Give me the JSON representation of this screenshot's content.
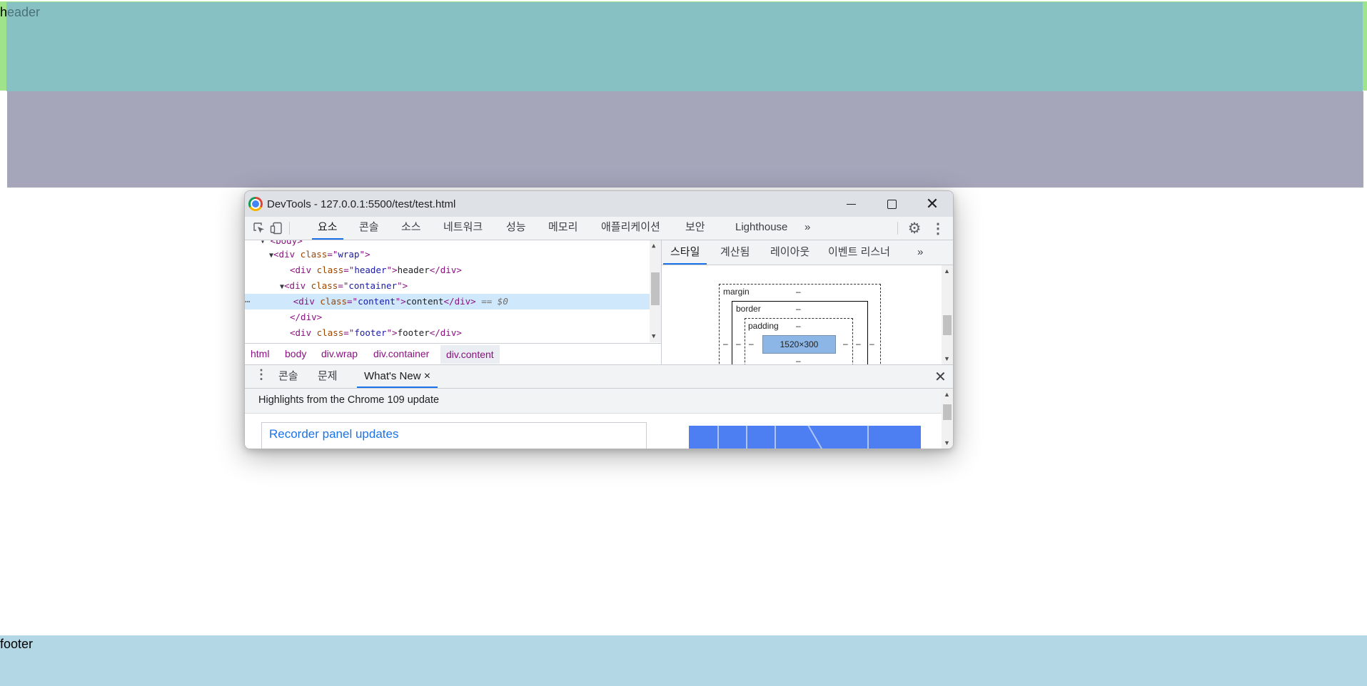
{
  "page": {
    "header_text": "header",
    "footer_text": "footer"
  },
  "devtools": {
    "title": "DevTools - 127.0.0.1:5500/test/test.html",
    "main_tabs": [
      "요소",
      "콘솔",
      "소스",
      "네트워크",
      "성능",
      "메모리",
      "애플리케이션",
      "보안",
      "Lighthouse"
    ],
    "active_tab": "요소",
    "more_tabs": "»",
    "dom": {
      "body_tag": "<body>",
      "wrap_open": [
        "<div ",
        "class",
        "=\"",
        "wrap",
        "\">"
      ],
      "header_line": [
        "<div ",
        "class",
        "=\"",
        "header",
        "\">",
        "header",
        "</div>"
      ],
      "container_open": [
        "<div ",
        "class",
        "=\"",
        "container",
        "\">"
      ],
      "content_line": [
        "<div ",
        "class",
        "=\"",
        "content",
        "\">",
        "content",
        "</div>"
      ],
      "selected_marker": "== $0",
      "ellipsis": "⋯",
      "close_div": "</div>",
      "footer_line": [
        "<div ",
        "class",
        "=\"",
        "footer",
        "\">",
        "footer",
        "</div>"
      ]
    },
    "breadcrumbs": [
      "html",
      "body",
      "div.wrap",
      "div.container",
      "div.content"
    ],
    "side_tabs": [
      "스타일",
      "계산됨",
      "레이아웃",
      "이벤트 리스너"
    ],
    "side_more": "»",
    "box_model": {
      "margin_label": "margin",
      "border_label": "border",
      "padding_label": "padding",
      "content_size": "1520×300",
      "dash": "–"
    },
    "drawer": {
      "tabs": [
        "콘솔",
        "문제",
        "What's New"
      ],
      "active_tab": "What's New",
      "tab_close": "×",
      "close": "✕",
      "highlights": "Highlights from the Chrome 109 update",
      "card_title": "Recorder panel updates"
    }
  },
  "colors": {
    "header_green": "#9fe38a",
    "header_teal": "#87c1c4",
    "content": "#a6a6bb",
    "footer": "#b3d7e5",
    "accent": "#1a73e8"
  }
}
